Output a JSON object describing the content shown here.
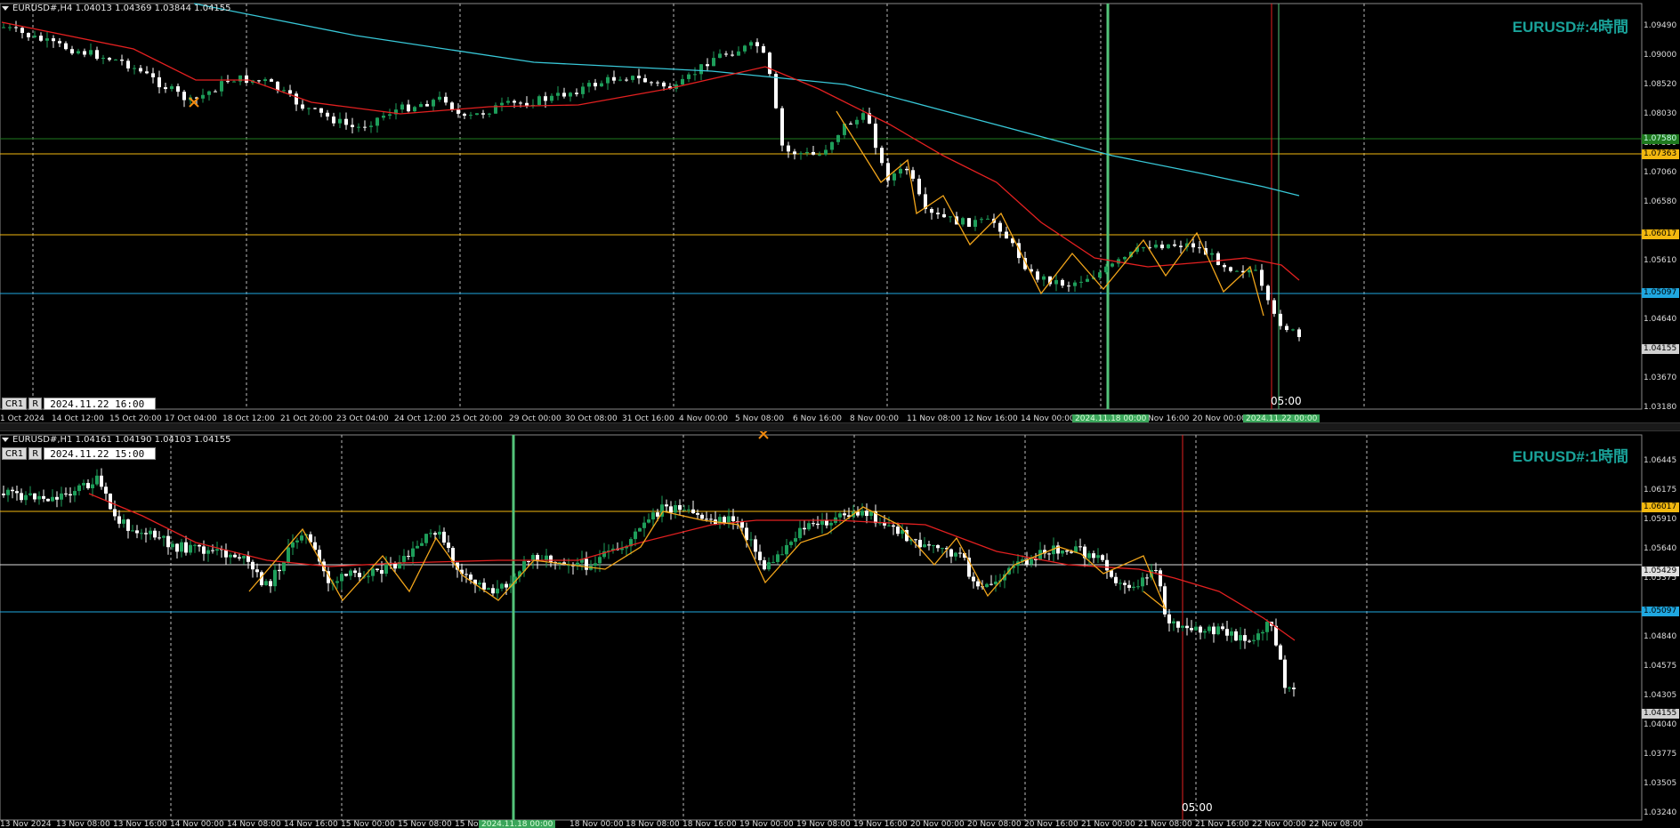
{
  "colors": {
    "bull": "#1e9e5a",
    "bear": "#ffffff",
    "ma_fast": "#e32020",
    "ma_slow": "#38c8d8",
    "zigzag": "#f2a51a",
    "level_yellow": "#f2b80f",
    "level_blue": "#1fa7e0",
    "level_white": "#dddddd",
    "level_green": "#1f7a1f",
    "vline_green": "#54c47a",
    "vline_red": "#e32020"
  },
  "top": {
    "info": "EURUSD#,H4  1.04013 1.04369 1.03844 1.04155",
    "watermark": "EURUSD#:4時間",
    "cr": "CR1",
    "r": "R",
    "crosshair_time": "2024.11.22 16:00",
    "time_marker": "05:00",
    "ylabels": [
      "1.09490",
      "1.09000",
      "1.08520",
      "1.08030",
      "1.07550",
      "1.07060",
      "1.06580",
      "1.05610",
      "1.04640",
      "1.04155",
      "1.03670",
      "1.03180"
    ],
    "tags": {
      "green": "1.07580",
      "yellow1": "1.07363",
      "yellow2": "1.06017",
      "blue": "1.05097",
      "price": "1.04155"
    },
    "xlabels": [
      "1 Oct 2024",
      "14 Oct 12:00",
      "15 Oct 20:00",
      "17 Oct 04:00",
      "18 Oct 12:00",
      "21 Oct 20:00",
      "23 Oct 04:00",
      "24 Oct 12:00",
      "25 Oct 20:00",
      "29 Oct 00:00",
      "30 Oct 08:00",
      "31 Oct 16:00",
      "4 Nov 00:00",
      "5 Nov 08:00",
      "6 Nov 16:00",
      "8 Nov 00:00",
      "11 Nov 08:00",
      "12 Nov 16:00",
      "14 Nov 00:00",
      "Nov 16:00",
      "20 Nov 00:00"
    ],
    "hl1": "2024.11.18 00:00",
    "hl2": "2024.11.22 00:00"
  },
  "bottom": {
    "info": "EURUSD#,H1  1.04161 1.04190 1.04103 1.04155",
    "watermark": "EURUSD#:1時間",
    "cr": "CR1",
    "r": "R",
    "crosshair_time": "2024.11.22 15:00",
    "time_marker": "05:00",
    "ylabels": [
      "1.06445",
      "1.06175",
      "1.05910",
      "1.05640",
      "1.05375",
      "1.05110",
      "1.04840",
      "1.04575",
      "1.04305",
      "1.04040",
      "1.03775",
      "1.03505",
      "1.03240"
    ],
    "tags": {
      "yellow": "1.06017",
      "white": "1.05429",
      "blue": "1.05097",
      "price": "1.04155"
    },
    "xlabels": [
      "13 Nov 2024",
      "13 Nov 08:00",
      "13 Nov 16:00",
      "14 Nov 00:00",
      "14 Nov 08:00",
      "14 Nov 16:00",
      "15 Nov 00:00",
      "15 Nov 08:00",
      "15 Nov",
      "18 Nov 00:00",
      "18 Nov 08:00",
      "18 Nov 16:00",
      "19 Nov 00:00",
      "19 Nov 08:00",
      "19 Nov 16:00",
      "20 Nov 00:00",
      "20 Nov 08:00",
      "20 Nov 16:00",
      "21 Nov 00:00",
      "21 Nov 08:00",
      "21 Nov 16:00",
      "22 Nov 00:00",
      "22 Nov 08:00"
    ],
    "hl1": "2024.11.18 00:00"
  }
}
